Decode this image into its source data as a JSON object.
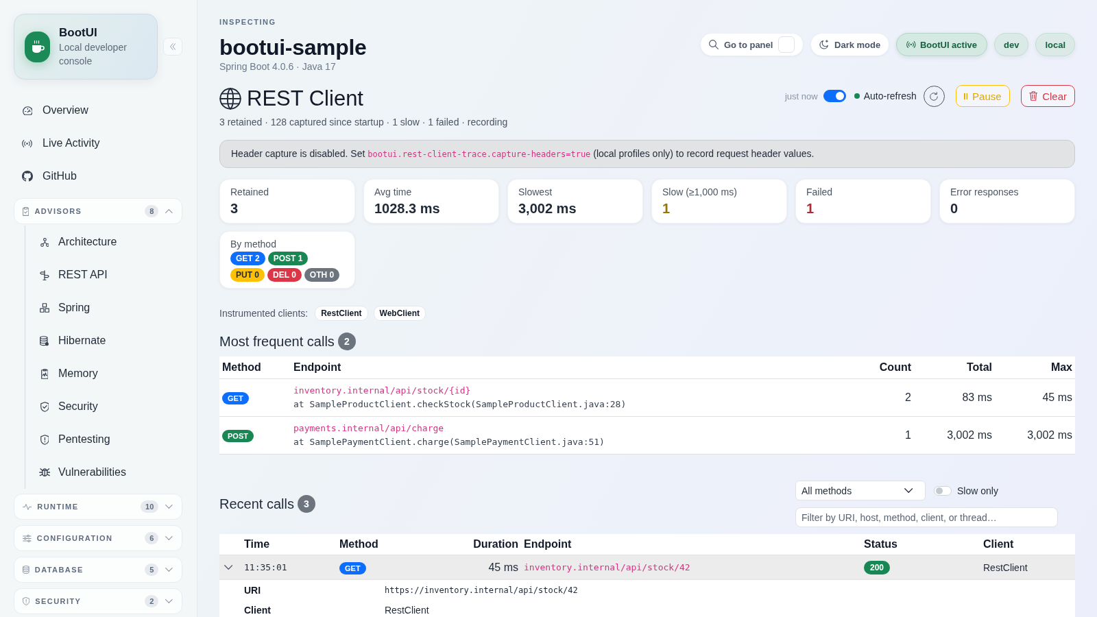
{
  "sidebar": {
    "brand": {
      "title": "BootUI",
      "subtitle": "Local developer console"
    },
    "nav": [
      {
        "label": "Overview"
      },
      {
        "label": "Live Activity"
      },
      {
        "label": "GitHub"
      }
    ],
    "groups": [
      {
        "label": "ADVISORS",
        "count": "8",
        "expanded": true,
        "children": [
          {
            "label": "Architecture"
          },
          {
            "label": "REST API"
          },
          {
            "label": "Spring"
          },
          {
            "label": "Hibernate"
          },
          {
            "label": "Memory"
          },
          {
            "label": "Security"
          },
          {
            "label": "Pentesting"
          },
          {
            "label": "Vulnerabilities"
          }
        ]
      },
      {
        "label": "RUNTIME",
        "count": "10",
        "expanded": false
      },
      {
        "label": "CONFIGURATION",
        "count": "6",
        "expanded": false
      },
      {
        "label": "DATABASE",
        "count": "5",
        "expanded": false
      },
      {
        "label": "SECURITY",
        "count": "2",
        "expanded": false
      }
    ]
  },
  "header": {
    "eyebrow": "INSPECTING",
    "title": "bootui-sample",
    "subtitle": "Spring Boot 4.0.6 · Java 17",
    "actions": [
      {
        "label": "Go to panel"
      },
      {
        "label": "Dark mode"
      }
    ],
    "pills": [
      {
        "label": "BootUI active",
        "kind": "status"
      },
      {
        "label": "dev",
        "kind": "profile"
      },
      {
        "label": "local",
        "kind": "profile"
      }
    ]
  },
  "panel": {
    "title": "REST Client",
    "summary": "3 retained · 128 captured since startup · 1 slow · 1 failed · recording",
    "updated": "just now",
    "auto_refresh": {
      "label": "Auto-refresh",
      "on": true
    },
    "buttons": [
      {
        "label": "Pause",
        "kind": "warning"
      },
      {
        "label": "Clear",
        "kind": "danger"
      }
    ]
  },
  "notice": {
    "parts": [
      {
        "kind": "text",
        "text": "Header capture is disabled. Set "
      },
      {
        "kind": "code",
        "text": "bootui.rest-client-trace.capture-headers=true"
      },
      {
        "kind": "text",
        "text": " (local profiles only) to record request header values."
      }
    ]
  },
  "stats": [
    {
      "label": "Retained",
      "value": "3",
      "kind": "plain"
    },
    {
      "label": "Avg time",
      "value": "1028.3 ms",
      "kind": "plain"
    },
    {
      "label": "Slowest",
      "value": "3,002 ms",
      "kind": "plain"
    },
    {
      "label": "Slow (≥1,000 ms)",
      "value": "1",
      "kind": "warning"
    },
    {
      "label": "Failed",
      "value": "1",
      "kind": "danger"
    },
    {
      "label": "Error responses",
      "value": "0",
      "kind": "plain"
    }
  ],
  "by_method": {
    "label": "By method",
    "badges": [
      {
        "label": "GET 2",
        "color": "#0d6efd"
      },
      {
        "label": "POST 1",
        "color": "#198754"
      },
      {
        "label": "PUT 0",
        "color": "#ffc107"
      },
      {
        "label": "DEL 0",
        "color": "#dc3545"
      },
      {
        "label": "OTH 0",
        "color": "#6c757d"
      }
    ]
  },
  "instrumented_clients": {
    "label": "Instrumented clients:",
    "clients": [
      "RestClient",
      "WebClient"
    ]
  },
  "frequent_calls": {
    "title": "Most frequent calls",
    "count": "2",
    "columns": [
      "Method",
      "Endpoint",
      "Count",
      "Total",
      "Max"
    ],
    "rows": [
      {
        "method": {
          "label": "GET",
          "color": "#0d6efd"
        },
        "endpoint": "inventory.internal/api/stock/{id}",
        "source": "at SampleProductClient.checkStock(SampleProductClient.java:28)",
        "count": "2",
        "total": "83 ms",
        "max": "45 ms"
      },
      {
        "method": {
          "label": "POST",
          "color": "#198754"
        },
        "endpoint": "payments.internal/api/charge",
        "source": "at SamplePaymentClient.charge(SamplePaymentClient.java:51)",
        "count": "1",
        "total": "3,002 ms",
        "max": "3,002 ms"
      }
    ]
  },
  "recent_calls": {
    "title": "Recent calls",
    "count": "3",
    "method_filter": "All methods",
    "slow_only": {
      "label": "Slow only",
      "on": false
    },
    "search": {
      "placeholder": "Filter by URI, host, method, client, or thread…"
    },
    "columns": [
      "Time",
      "Method",
      "Duration",
      "Endpoint",
      "Status",
      "Client"
    ],
    "rows": [
      {
        "expanded": true,
        "time": "11:35:01",
        "method": {
          "label": "GET",
          "color": "#0d6efd"
        },
        "duration": "45 ms",
        "endpoint": "inventory.internal/api/stock/42",
        "status": {
          "label": "200",
          "color": "#198754"
        },
        "client": "RestClient",
        "details": [
          {
            "label": "URI",
            "value": "https://inventory.internal/api/stock/42",
            "kind": "code"
          },
          {
            "label": "Client",
            "value": "RestClient",
            "kind": "text"
          }
        ]
      }
    ]
  }
}
